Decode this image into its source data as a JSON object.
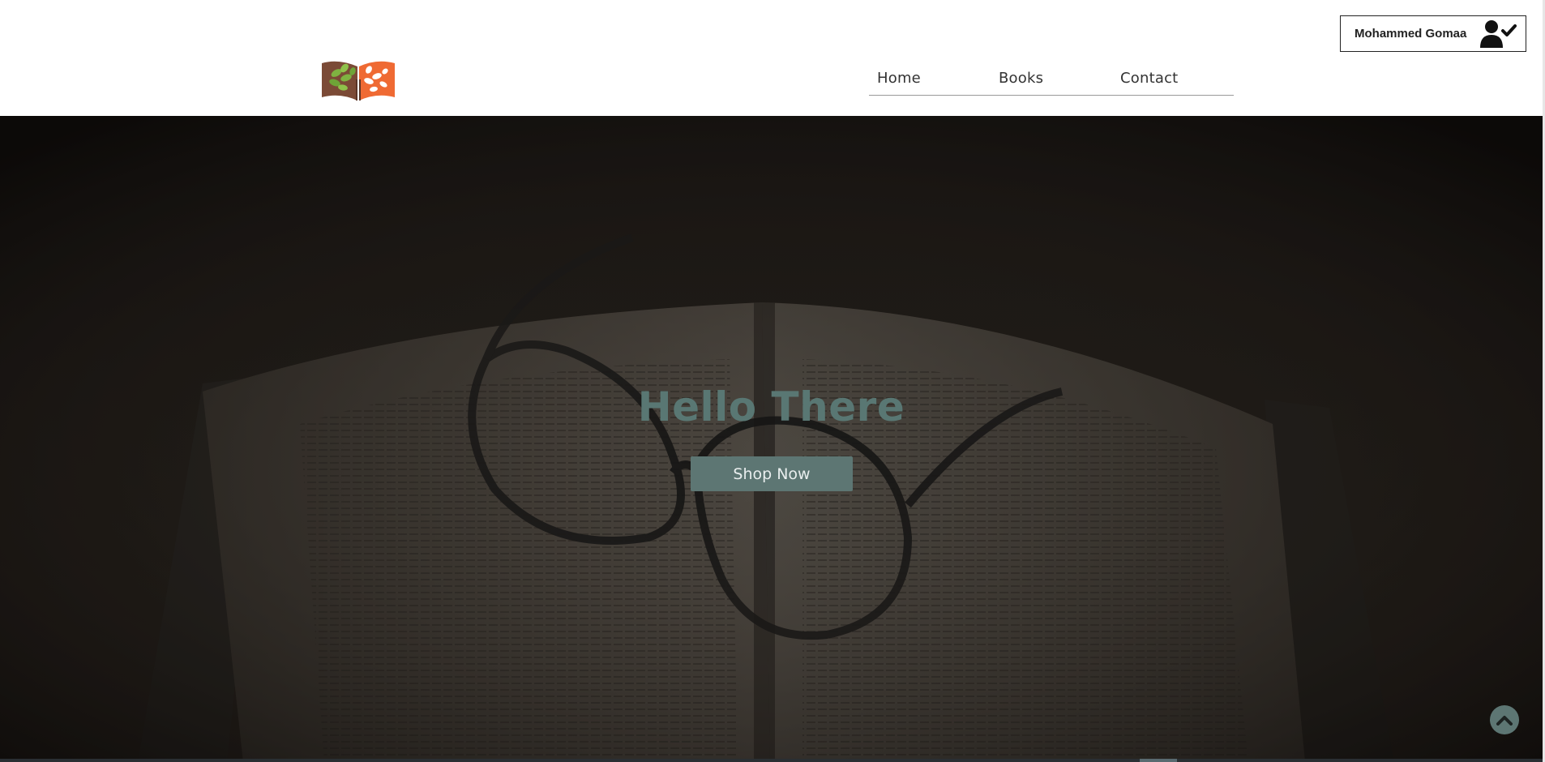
{
  "header": {
    "logo_icon": "open-book-tree-logo",
    "nav": [
      {
        "label": "Home"
      },
      {
        "label": "Books"
      },
      {
        "label": "Contact"
      }
    ],
    "user": {
      "name": "Mohammed Gomaa",
      "icon": "user-check-icon"
    }
  },
  "hero": {
    "title": "Hello There",
    "cta_label": "Shop Now",
    "scroll_top_icon": "chevron-up-icon"
  },
  "colors": {
    "accent": "#5d7673",
    "hero_title": "#597773",
    "logo_green": "#7fb241",
    "logo_orange": "#ef6a33",
    "logo_brown": "#7b4a36"
  }
}
